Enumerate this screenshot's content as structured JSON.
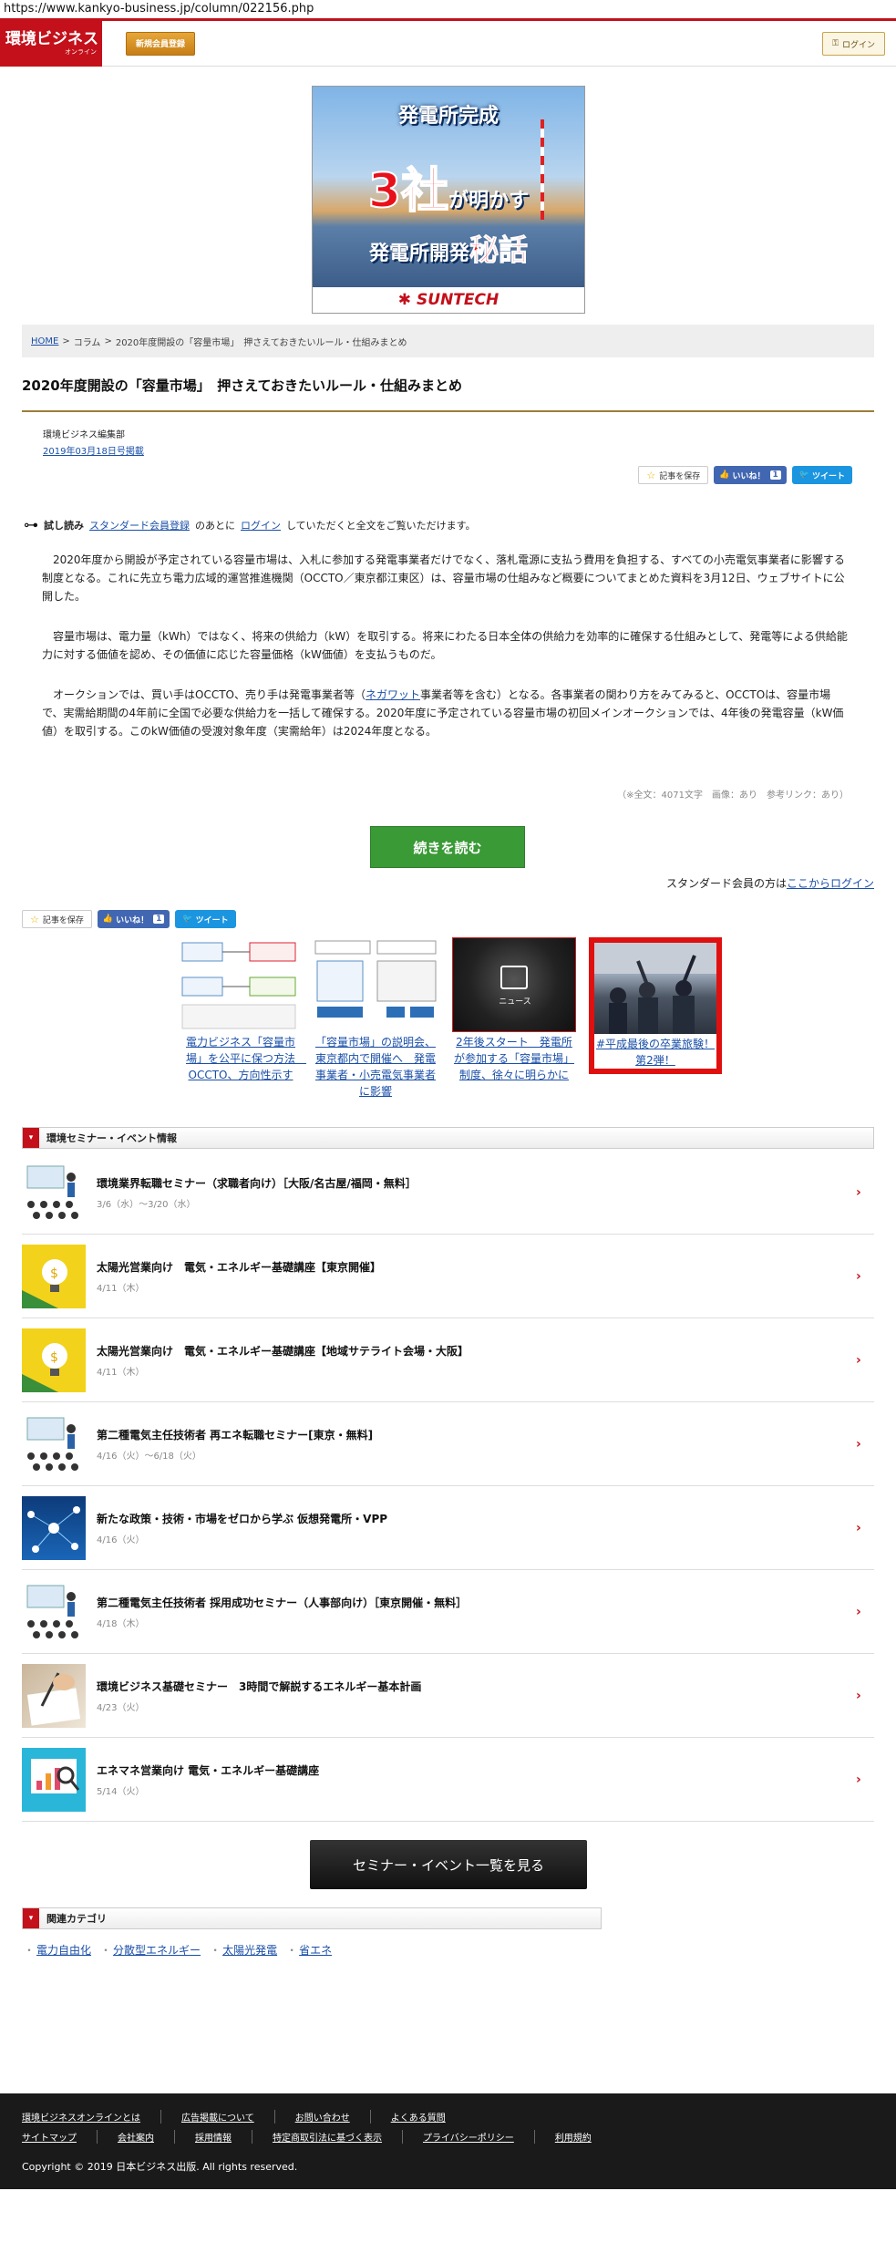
{
  "browser": {
    "url": "https://www.kankyo-business.jp/column/022156.php"
  },
  "header": {
    "logo_main": "環境ビジネス",
    "logo_sub": "オンライン",
    "register_label": "新規会員登録",
    "login_label": "ログイン"
  },
  "banner": {
    "line1": "発電所完成",
    "big": "3社",
    "line2": "が明かす",
    "line3": "発電所開発",
    "line3_red": "秘話",
    "brand": "SUNTECH"
  },
  "breadcrumb": {
    "home": "HOME",
    "sep": ">",
    "column": "コラム",
    "current": "2020年度開設の「容量市場」　押さえておきたいルール・仕組みまとめ"
  },
  "article": {
    "title": "2020年度開設の「容量市場」　押さえておきたいルール・仕組みまとめ",
    "author": "環境ビジネス編集部",
    "date": "2019年03月18日号掲載",
    "trial_label": "試し読み",
    "trial_link1": "スタンダード会員登録",
    "trial_mid": "のあとに",
    "trial_link2": "ログイン",
    "trial_end": "していただくと全文をご覧いただけます。",
    "p1": "2020年度から開設が予定されている容量市場は、入札に参加する発電事業者だけでなく、落札電源に支払う費用を負担する、すべての小売電気事業者に影響する制度となる。これに先立ち電力広域的運営推進機関（OCCTO／東京都江東区）は、容量市場の仕組みなど概要についてまとめた資料を3月12日、ウェブサイトに公開した。",
    "p2": "容量市場は、電力量（kWh）ではなく、将来の供給力（kW）を取引する。将来にわたる日本全体の供給力を効率的に確保する仕組みとして、発電等による供給能力に対する価値を認め、その価値に応じた容量価格（kW価値）を支払うものだ。",
    "p3_a": "オークションでは、買い手はOCCTO、売り手は発電事業者等（",
    "p3_link": "ネガワット",
    "p3_b": "事業者等を含む）となる。各事業者の関わり方をみてみると、OCCTOは、容量市場で、実需給期間の4年前に全国で必要な供給力を一括して確保する。2020年度に予定されている容量市場の初回メインオークションでは、4年後の発電容量（kW価値）を取引する。このkW価値の受渡対象年度（実需給年）は2024年度となる。",
    "fulltext": "（※全文：4071文字　画像：あり　参考リンク：あり）",
    "read_more": "続きを読む",
    "member_prefix": "スタンダード会員の方は",
    "member_link": "ここからログイン"
  },
  "social": {
    "save": "記事を保存",
    "like": "いいね！",
    "like_count": "1",
    "tweet": "ツイート"
  },
  "related": [
    {
      "caption": "電力ビジネス「容量市場」を公平に保つ方法　OCCTO、方向性示す"
    },
    {
      "caption": "「容量市場」の説明会、東京都内で開催へ　発電事業者・小売電気事業者に影響"
    },
    {
      "caption": "2年後スタート　発電所が参加する「容量市場」制度、徐々に明らかに",
      "badge": "ニュース"
    },
    {
      "caption": "#平成最後の卒業旅験！第2弾！"
    }
  ],
  "events_section": {
    "title": "環境セミナー・イベント情報"
  },
  "events": [
    {
      "title": "環境業界転職セミナー（求職者向け）［大阪/名古屋/福岡・無料］",
      "date": "3/6（水）～3/20（水）"
    },
    {
      "title": "太陽光営業向け　電気・エネルギー基礎講座【東京開催】",
      "date": "4/11（木）"
    },
    {
      "title": "太陽光営業向け　電気・エネルギー基礎講座【地域サテライト会場・大阪】",
      "date": "4/11（木）"
    },
    {
      "title": "第二種電気主任技術者 再エネ転職セミナー[東京・無料]",
      "date": "4/16（火）～6/18（火）"
    },
    {
      "title": "新たな政策・技術・市場をゼロから学ぶ 仮想発電所・VPP",
      "date": "4/16（火）"
    },
    {
      "title": "第二種電気主任技術者 採用成功セミナー（人事部向け）［東京開催・無料］",
      "date": "4/18（木）"
    },
    {
      "title": "環境ビジネス基礎セミナー　3時間で解説するエネルギー基本計画",
      "date": "4/23（火）"
    },
    {
      "title": "エネマネ営業向け 電気・エネルギー基礎講座",
      "date": "5/14（火）"
    }
  ],
  "see_all": "セミナー・イベント一覧を見る",
  "category_section": {
    "title": "関連カテゴリ"
  },
  "categories": [
    "電力自由化",
    "分散型エネルギー",
    "太陽光発電",
    "省エネ"
  ],
  "footer": {
    "row1": [
      "環境ビジネスオンラインとは",
      "広告掲載について",
      "お問い合わせ",
      "よくある質問"
    ],
    "row2": [
      "サイトマップ",
      "会社案内",
      "採用情報",
      "特定商取引法に基づく表示",
      "プライバシーポリシー",
      "利用規約"
    ],
    "copyright": "Copyright © 2019 日本ビジネス出版. All rights reserved."
  },
  "colors": {
    "brand_red": "#c3101a",
    "read_more_green": "#3a9a36",
    "link_blue": "#1a4fa8"
  }
}
